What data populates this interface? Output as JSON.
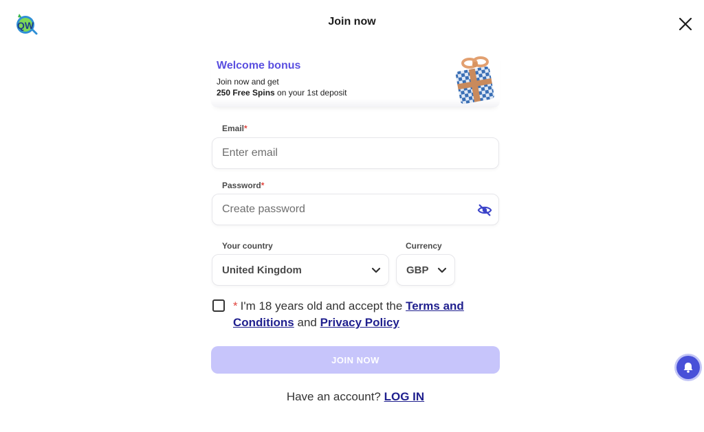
{
  "header": {
    "title": "Join now",
    "logo_icon": "qw-logo-icon",
    "close_icon": "close-icon"
  },
  "bonus": {
    "title": "Welcome bonus",
    "line1": "Join now and get",
    "line2_bold": "250 Free Spins",
    "line2_rest": " on your 1st deposit",
    "image_icon": "gift-box-icon"
  },
  "email": {
    "label": "Email",
    "required_mark": "*",
    "placeholder": "Enter email",
    "value": ""
  },
  "password": {
    "label": "Password",
    "required_mark": "*",
    "placeholder": "Create password",
    "value": "",
    "toggle_icon": "eye-slash-icon"
  },
  "country": {
    "label": "Your country",
    "selected": "United Kingdom"
  },
  "currency": {
    "label": "Currency",
    "selected": "GBP"
  },
  "terms": {
    "checked": false,
    "required_mark": "*",
    "text_prefix": "I'm 18 years old and accept the ",
    "terms_link": "Terms and Conditions",
    "text_and": " and ",
    "privacy_link": "Privacy Policy"
  },
  "join_button": {
    "label": "JOIN NOW"
  },
  "login": {
    "prompt": "Have an account? ",
    "link": "LOG IN"
  },
  "notification": {
    "icon": "bell-icon"
  },
  "colors": {
    "accent": "#5a4fe0",
    "link": "#1f1f8e",
    "button_disabled": "#c7c5fb",
    "required": "#e0443d"
  }
}
